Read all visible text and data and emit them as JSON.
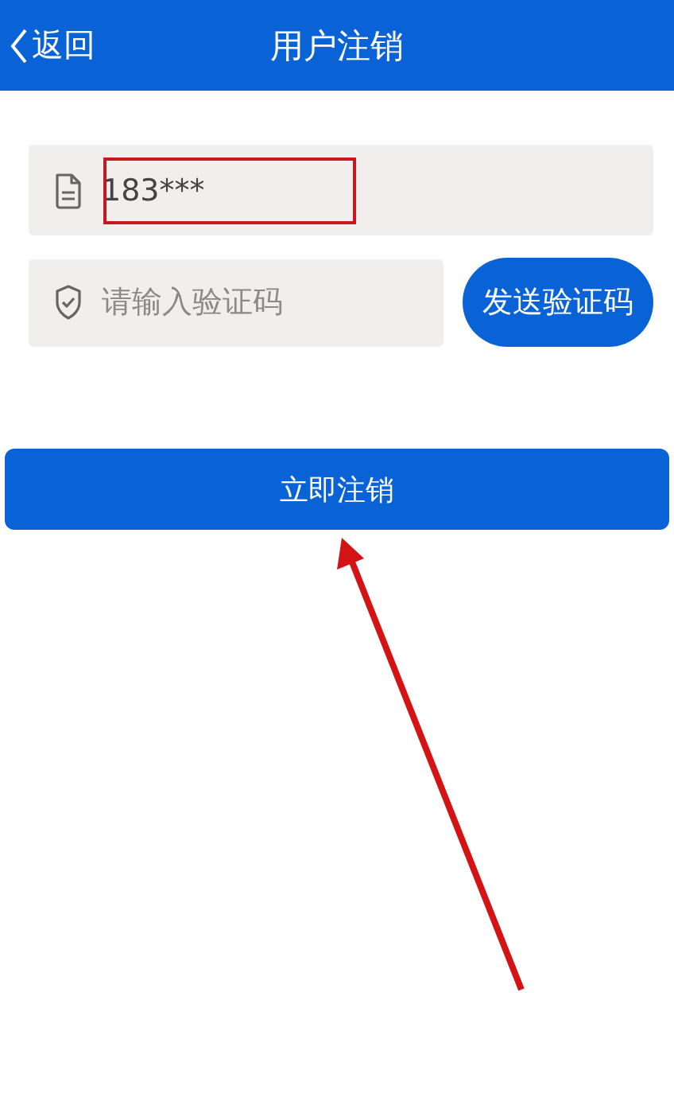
{
  "header": {
    "back": "返回",
    "title": "用户注销"
  },
  "phone_field": {
    "value": "183***",
    "highlighted": true
  },
  "code_field": {
    "placeholder": "请输入验证码"
  },
  "send_button": "发送验证码",
  "submit_button": "立即注销",
  "annotation_arrow": true
}
